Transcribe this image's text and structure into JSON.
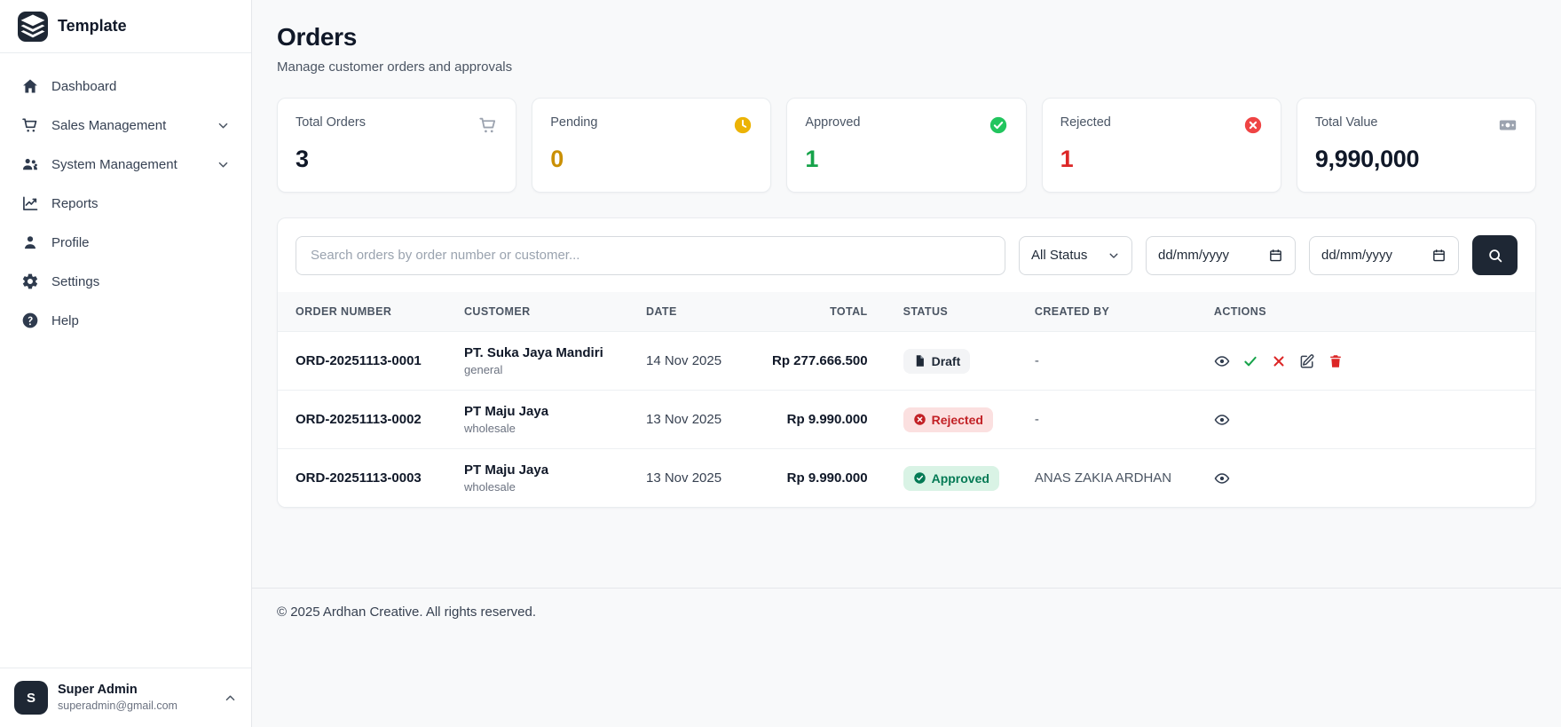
{
  "app": {
    "brand": "Template"
  },
  "sidebar": {
    "items": [
      {
        "label": "Dashboard",
        "icon": "home",
        "expandable": false
      },
      {
        "label": "Sales Management",
        "icon": "cart",
        "expandable": true
      },
      {
        "label": "System Management",
        "icon": "users",
        "expandable": true
      },
      {
        "label": "Reports",
        "icon": "chart",
        "expandable": false
      },
      {
        "label": "Profile",
        "icon": "user",
        "expandable": false
      },
      {
        "label": "Settings",
        "icon": "gear",
        "expandable": false
      },
      {
        "label": "Help",
        "icon": "help",
        "expandable": false
      }
    ],
    "user": {
      "initial": "S",
      "name": "Super Admin",
      "email": "superadmin@gmail.com"
    }
  },
  "header": {
    "title": "Orders",
    "subtitle": "Manage customer orders and approvals"
  },
  "stats": [
    {
      "label": "Total Orders",
      "value": "3",
      "icon": "cart",
      "color": "#101828"
    },
    {
      "label": "Pending",
      "value": "0",
      "icon": "clock",
      "color": "#ca9004"
    },
    {
      "label": "Approved",
      "value": "1",
      "icon": "check-circle",
      "color": "#16a34a"
    },
    {
      "label": "Rejected",
      "value": "1",
      "icon": "x-circle",
      "color": "#dc2626"
    },
    {
      "label": "Total Value",
      "value": "9,990,000",
      "icon": "banknote",
      "color": "#101828"
    }
  ],
  "filters": {
    "search_placeholder": "Search orders by order number or customer...",
    "status_selected": "All Status",
    "date_from": "dd/mm/yyyy",
    "date_to": "dd/mm/yyyy"
  },
  "table": {
    "columns": [
      "Order Number",
      "Customer",
      "Date",
      "Total",
      "Status",
      "Created By",
      "Actions"
    ],
    "rows": [
      {
        "order_number": "ORD-20251113-0001",
        "customer": "PT. Suka Jaya Mandiri",
        "customer_type": "general",
        "date": "14 Nov 2025",
        "total": "Rp 277.666.500",
        "status": "Draft",
        "created_by": "-",
        "actions": [
          "view",
          "approve",
          "reject",
          "edit",
          "delete"
        ]
      },
      {
        "order_number": "ORD-20251113-0002",
        "customer": "PT Maju Jaya",
        "customer_type": "wholesale",
        "date": "13 Nov 2025",
        "total": "Rp 9.990.000",
        "status": "Rejected",
        "created_by": "-",
        "actions": [
          "view"
        ]
      },
      {
        "order_number": "ORD-20251113-0003",
        "customer": "PT Maju Jaya",
        "customer_type": "wholesale",
        "date": "13 Nov 2025",
        "total": "Rp 9.990.000",
        "status": "Approved",
        "created_by": "ANAS ZAKIA ARDHAN",
        "actions": [
          "view"
        ]
      }
    ]
  },
  "status_colors": {
    "draft": "#1f2937",
    "rejected": "#c22126",
    "approved": "#057a55"
  },
  "footer": {
    "copyright": "© 2025 Ardhan Creative. All rights reserved."
  }
}
